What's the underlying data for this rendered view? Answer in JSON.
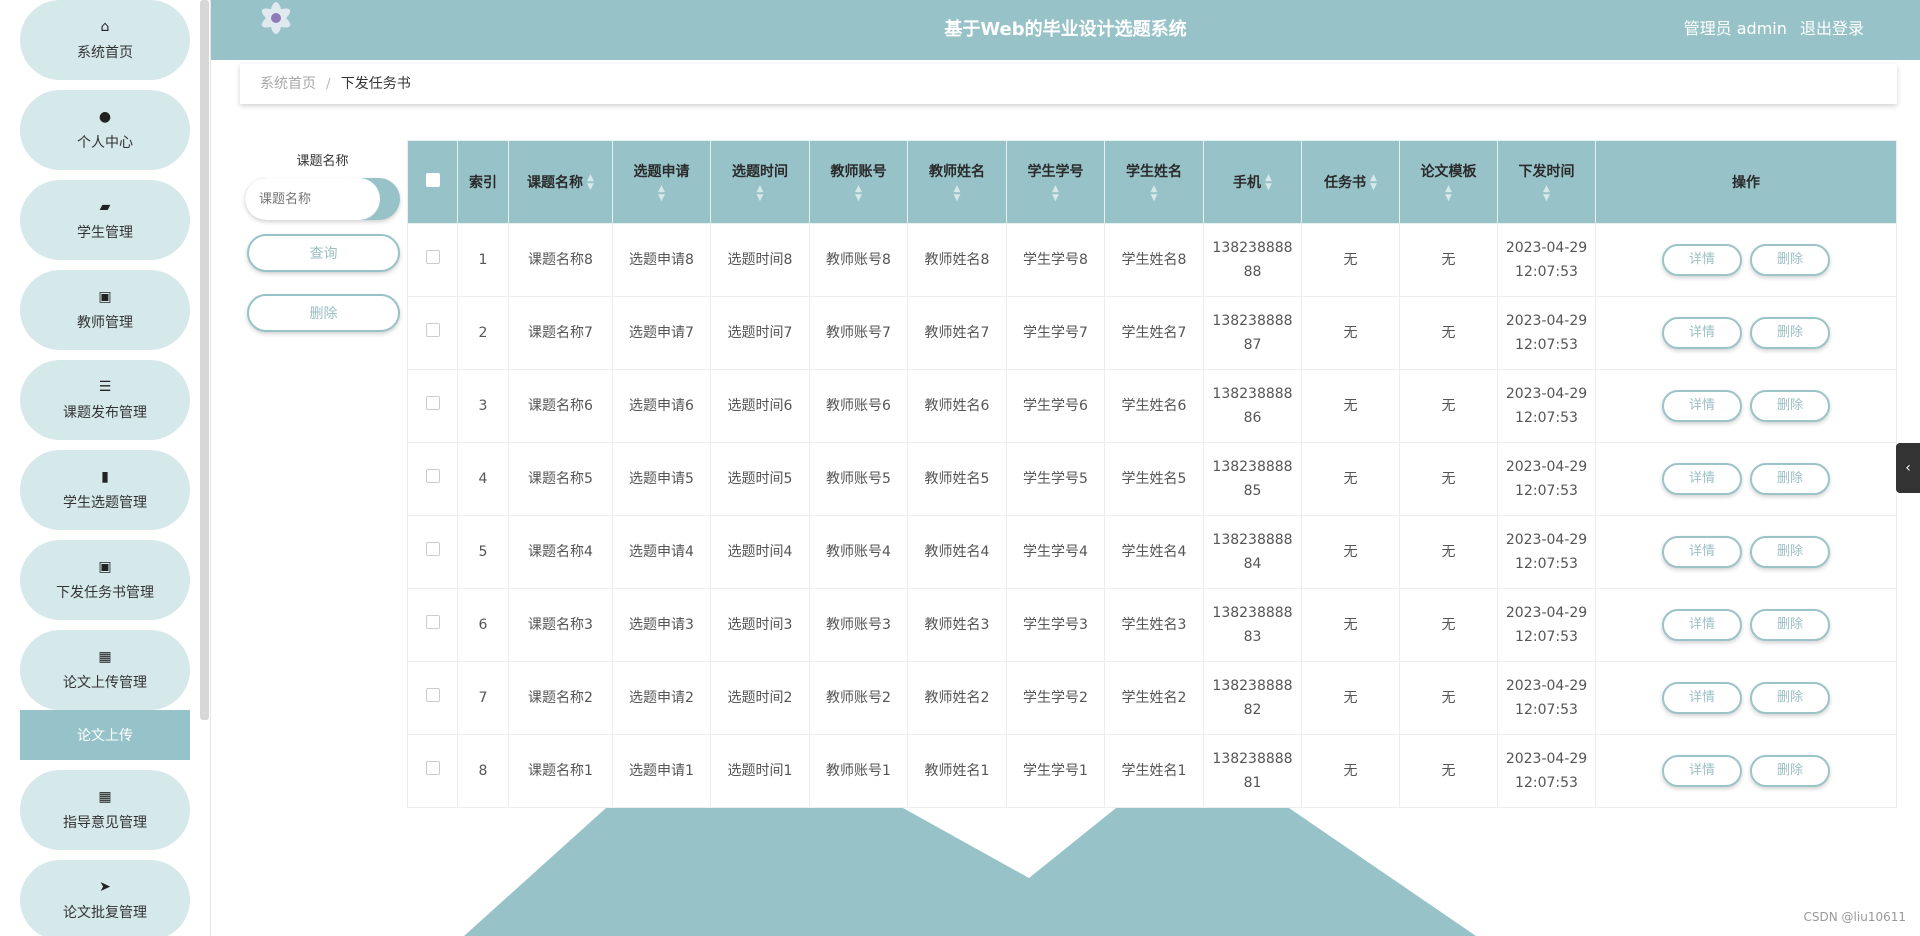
{
  "header": {
    "title": "基于Web的毕业设计选题系统",
    "user": "管理员 admin",
    "logout": "退出登录"
  },
  "sidebar": {
    "items": [
      {
        "label": "系统首页",
        "icon": "home-icon",
        "glyph": "⌂"
      },
      {
        "label": "个人中心",
        "icon": "user-icon",
        "glyph": "●"
      },
      {
        "label": "学生管理",
        "icon": "wallet-icon",
        "glyph": "▰"
      },
      {
        "label": "教师管理",
        "icon": "clipboard-check-icon",
        "glyph": "▣"
      },
      {
        "label": "课题发布管理",
        "icon": "sliders-icon",
        "glyph": "☰"
      },
      {
        "label": "学生选题管理",
        "icon": "book-icon",
        "glyph": "▮"
      },
      {
        "label": "下发任务书管理",
        "icon": "clipboard-x-icon",
        "glyph": "▣"
      },
      {
        "label": "论文上传管理",
        "icon": "grid-icon",
        "glyph": "▦"
      },
      {
        "label": "指导意见管理",
        "icon": "grid-icon",
        "glyph": "▦"
      },
      {
        "label": "论文批复管理",
        "icon": "send-icon",
        "glyph": "➤"
      }
    ],
    "subitem": "论文上传"
  },
  "breadcrumb": {
    "home": "系统首页",
    "separator": "/",
    "current": "下发任务书"
  },
  "search": {
    "label": "课题名称",
    "placeholder": "课题名称",
    "query_button": "查询",
    "delete_button": "删除"
  },
  "table": {
    "headers": [
      "索引",
      "课题名称",
      "选题申请",
      "选题时间",
      "教师账号",
      "教师姓名",
      "学生学号",
      "学生姓名",
      "手机",
      "任务书",
      "论文模板",
      "下发时间",
      "操作"
    ],
    "rows": [
      [
        "1",
        "课题名称8",
        "选题申请8",
        "选题时间8",
        "教师账号8",
        "教师姓名8",
        "学生学号8",
        "学生姓名8",
        "13823888888",
        "无",
        "无",
        "2023-04-29 12:07:53"
      ],
      [
        "2",
        "课题名称7",
        "选题申请7",
        "选题时间7",
        "教师账号7",
        "教师姓名7",
        "学生学号7",
        "学生姓名7",
        "13823888887",
        "无",
        "无",
        "2023-04-29 12:07:53"
      ],
      [
        "3",
        "课题名称6",
        "选题申请6",
        "选题时间6",
        "教师账号6",
        "教师姓名6",
        "学生学号6",
        "学生姓名6",
        "13823888886",
        "无",
        "无",
        "2023-04-29 12:07:53"
      ],
      [
        "4",
        "课题名称5",
        "选题申请5",
        "选题时间5",
        "教师账号5",
        "教师姓名5",
        "学生学号5",
        "学生姓名5",
        "13823888885",
        "无",
        "无",
        "2023-04-29 12:07:53"
      ],
      [
        "5",
        "课题名称4",
        "选题申请4",
        "选题时间4",
        "教师账号4",
        "教师姓名4",
        "学生学号4",
        "学生姓名4",
        "13823888884",
        "无",
        "无",
        "2023-04-29 12:07:53"
      ],
      [
        "6",
        "课题名称3",
        "选题申请3",
        "选题时间3",
        "教师账号3",
        "教师姓名3",
        "学生学号3",
        "学生姓名3",
        "13823888883",
        "无",
        "无",
        "2023-04-29 12:07:53"
      ],
      [
        "7",
        "课题名称2",
        "选题申请2",
        "选题时间2",
        "教师账号2",
        "教师姓名2",
        "学生学号2",
        "学生姓名2",
        "13823888882",
        "无",
        "无",
        "2023-04-29 12:07:53"
      ],
      [
        "8",
        "课题名称1",
        "选题申请1",
        "选题时间1",
        "教师账号1",
        "教师姓名1",
        "学生学号1",
        "学生姓名1",
        "13823888881",
        "无",
        "无",
        "2023-04-29 12:07:53"
      ]
    ],
    "detail_label": "详情",
    "delete_label": "删除"
  },
  "colors": {
    "accent": "#97c3c8",
    "menu_bg": "#d5e8ea"
  },
  "watermark": "CSDN @liu10611"
}
